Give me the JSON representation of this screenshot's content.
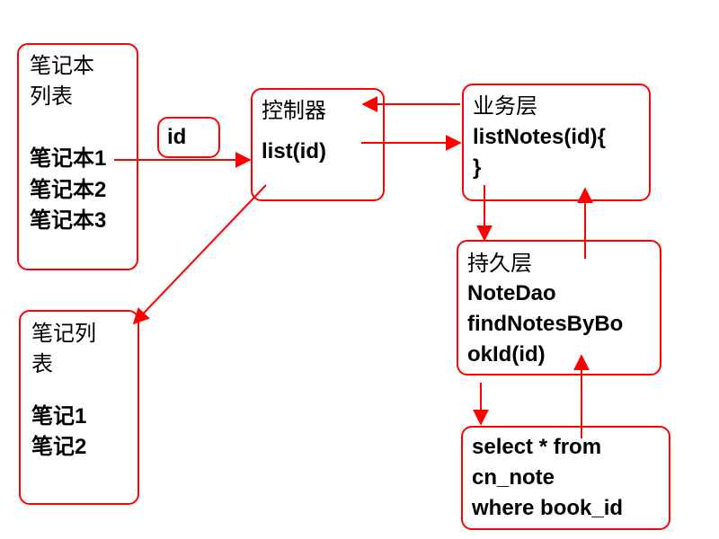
{
  "colors": {
    "border": "#ff0000",
    "arrow": "#ff0000",
    "text": "#000000"
  },
  "notebook_list": {
    "title_line1": "笔记本",
    "title_line2": "列表",
    "items": [
      "笔记本1",
      "笔记本2",
      "笔记本3"
    ]
  },
  "id_param": {
    "label": "id"
  },
  "controller": {
    "title": "控制器",
    "method": "list(id)"
  },
  "service": {
    "title": "业务层",
    "line1": "listNotes(id){",
    "line2": "}"
  },
  "persistence": {
    "title": "持久层",
    "line1": "NoteDao",
    "line2": "findNotesByBo",
    "line3": "okId(id)"
  },
  "sql": {
    "line1": "select * from",
    "line2": "cn_note",
    "line3": "where book_id"
  },
  "note_list": {
    "title_line1": "笔记列",
    "title_line2": "表",
    "items": [
      "笔记1",
      "笔记2"
    ]
  }
}
